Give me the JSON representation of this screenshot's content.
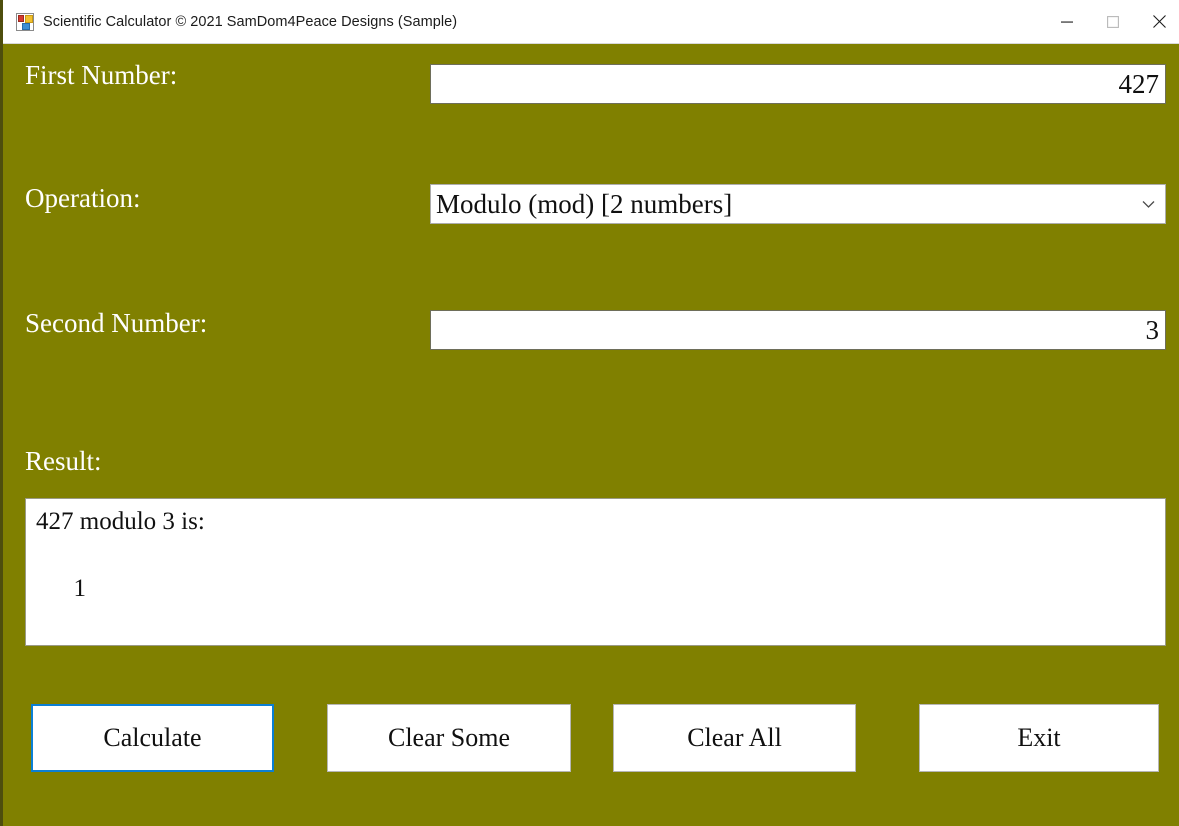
{
  "window": {
    "title": "Scientific Calculator © 2021 SamDom4Peace Designs (Sample)",
    "icon": "app-form-icon",
    "background_color": "#808000",
    "controls": {
      "minimize": "minimize-icon",
      "maximize": "maximize-icon",
      "close": "close-icon"
    }
  },
  "form": {
    "first_number": {
      "label": "First Number:",
      "value": "427",
      "placeholder": ""
    },
    "operation": {
      "label": "Operation:",
      "selected": "Modulo (mod) [2 numbers]",
      "arrow_icon": "chevron-down-icon"
    },
    "second_number": {
      "label": "Second Number:",
      "value": "3",
      "placeholder": ""
    },
    "result": {
      "label": "Result:",
      "value": "427 modulo 3 is:\n\n      1"
    }
  },
  "buttons": {
    "calculate": "Calculate",
    "clear_some": "Clear Some",
    "clear_all": "Clear All",
    "exit": "Exit",
    "focus_color": "#0b7fd4"
  }
}
